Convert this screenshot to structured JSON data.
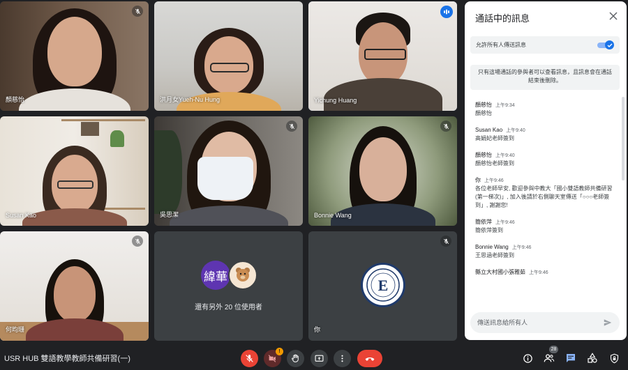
{
  "tiles": [
    {
      "name": "顏慈怡",
      "mic": "off"
    },
    {
      "name": "洪月女Yueh-Nu Hung",
      "mic": "none"
    },
    {
      "name": "Yichung Huang",
      "mic": "speaking"
    },
    {
      "name": "Susan Kao",
      "mic": "none"
    },
    {
      "name": "吳思潔",
      "mic": "off"
    },
    {
      "name": "Bonnie Wang",
      "mic": "off"
    },
    {
      "name": "何昀珊",
      "mic": "off"
    }
  ],
  "others": {
    "avatar_text": "緯華",
    "label": "還有另外 20 位使用者"
  },
  "self_tile": {
    "name": "你"
  },
  "chat": {
    "title": "通話中的訊息",
    "allow_label": "允許所有人傳送訊息",
    "allow_enabled": true,
    "notice": "只有這場通話的參與者可以查看訊息，且訊息會在通話結束後刪除。",
    "placeholder": "傳送訊息給所有人",
    "messages": [
      {
        "sender": "顏慈怡",
        "time": "上午9:34",
        "text": "顏慈怡"
      },
      {
        "sender": "Susan Kao",
        "time": "上午9:40",
        "text": "高娟妃老師簽到"
      },
      {
        "sender": "顏慈怡",
        "time": "上午9:40",
        "text": "顏慈怡老師簽到"
      },
      {
        "sender": "你",
        "time": "上午9:46",
        "text": "各位老師早安, 歡迎參與中教大「國小雙語教師共備研習(第一梯次)」, 加入後請於右側聊天室傳送「○○○老師簽到」, 謝謝您!"
      },
      {
        "sender": "簡依萍",
        "time": "上午9:46",
        "text": "簡依萍簽到"
      },
      {
        "sender": "Bonnie Wang",
        "time": "上午9:46",
        "text": "王思涵老師簽到"
      },
      {
        "sender": "縣立大村國小張雅茹",
        "time": "上午9:46",
        "text": ""
      }
    ]
  },
  "bottom": {
    "meeting_title": "USR HUB 雙語教學教師共備研習(一)",
    "camera_warning": "!",
    "participant_count": "28"
  },
  "colors": {
    "accent": "#1a73e8",
    "end_call": "#ea4335",
    "background": "#202124",
    "tile": "#3c4043"
  }
}
